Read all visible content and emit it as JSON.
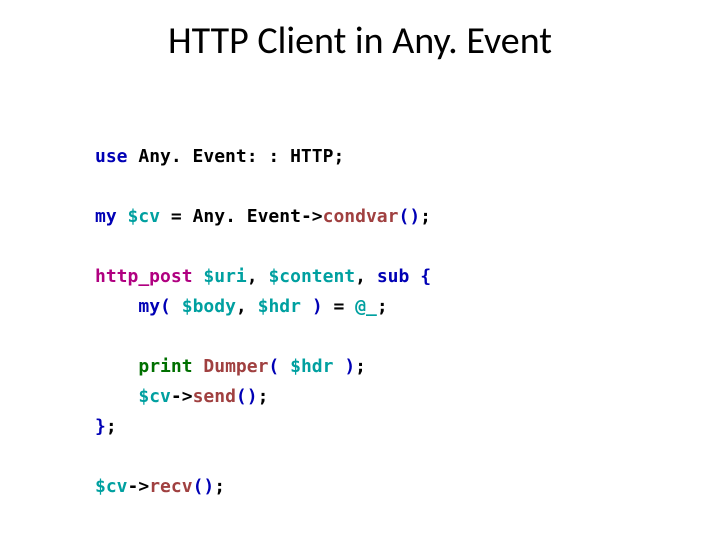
{
  "title": "HTTP Client in Any. Event",
  "code": {
    "l1": {
      "use": "use",
      "sp": " ",
      "mod": "Any. Event: : HTTP",
      "semi": ";"
    },
    "l3": {
      "my": "my",
      "sp": " ",
      "var": "$cv",
      "eq": " = ",
      "cls": "Any. Event",
      "arrow": "->",
      "meth": "condvar",
      "op": "(",
      "cp": ")",
      "semi": ";"
    },
    "l5": {
      "fn": "http_post",
      "sp": " ",
      "v1": "$uri",
      "c1": ", ",
      "v2": "$content",
      "c2": ", ",
      "sub": "sub",
      "sp2": " ",
      "ob": "{"
    },
    "l6": {
      "indent": "    ",
      "my": "my",
      "op": "(",
      "sp": " ",
      "v1": "$body",
      "c1": ", ",
      "v2": "$hdr",
      "sp2": " ",
      "cp": ")",
      "eq": " = ",
      "at": "@_",
      "semi": ";"
    },
    "l8": {
      "indent": "    ",
      "pr": "print",
      "sp": " ",
      "dm": "Dumper",
      "op": "(",
      "sp2": " ",
      "v": "$hdr",
      "sp3": " ",
      "cp": ")",
      "semi": ";"
    },
    "l9": {
      "indent": "    ",
      "v": "$cv",
      "arrow": "->",
      "meth": "send",
      "op": "(",
      "cp": ")",
      "semi": ";"
    },
    "l10": {
      "cb": "}",
      "semi": ";"
    },
    "l12": {
      "v": "$cv",
      "arrow": "->",
      "meth": "recv",
      "op": "(",
      "cp": ")",
      "semi": ";"
    }
  }
}
